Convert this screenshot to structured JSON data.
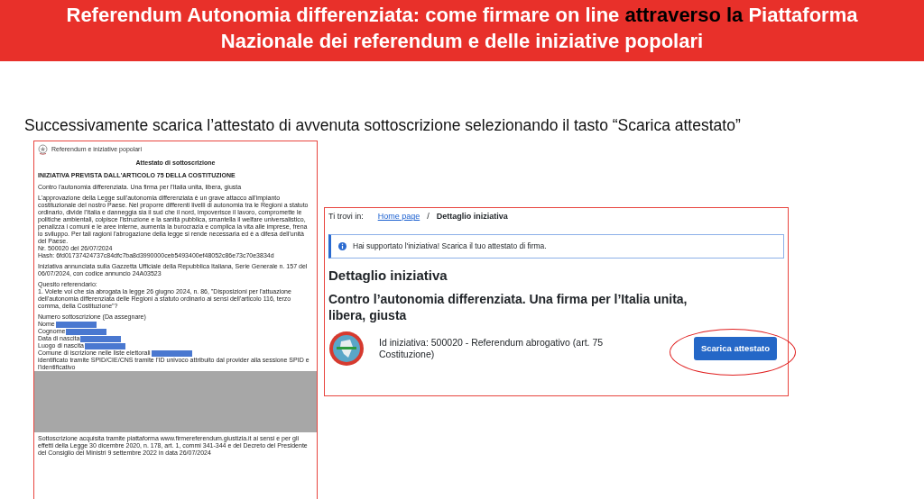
{
  "slide_title": {
    "segments": [
      {
        "text": "Referendum Autonomia differenziata: come firmare on line ",
        "emphasis": false
      },
      {
        "text": "attraverso la",
        "emphasis": true
      },
      {
        "text": " Piattaforma Nazionale dei referendum e delle iniziative popolari",
        "emphasis": false
      }
    ]
  },
  "instruction": "Successivamente scarica l’attestato di avvenuta sottoscrizione selezionando il tasto “Scarica attestato”",
  "certificate": {
    "header": "Referendum e iniziative popolari",
    "title": "Attestato di sottoscrizione",
    "heading": "INIZIATIVA PREVISTA DALL'ARTICOLO 75 DELLA COSTITUZIONE",
    "paragraphs": [
      [
        "Contro l'autonomia differenziata. Una firma per l'Italia unita, libera, giusta"
      ],
      [
        "L'approvazione della Legge sull'autonomia differenziata è un grave attacco all'impianto costituzionale del nostro Paese. Nel proporre differenti livelli di autonomia tra le Regioni a statuto ordinario, divide l'Italia e danneggia sia il sud che il nord, impoverisce il lavoro, compromette le politiche ambientali, colpisce l'istruzione e la sanità pubblica, smantella il welfare universalistico, penalizza i comuni e le aree interne, aumenta la burocrazia e complica la vita alle imprese, frena lo sviluppo. Per tali ragioni l'abrogazione della legge si rende necessaria ed è a difesa dell'unità del Paese.",
        "Nr. 500020 del 26/07/2024",
        "Hash: 6fd01737424737c84dfc7ba8d3990000ceb5493400ef48052c86e73c70e3834d"
      ],
      [
        "Iniziativa annunciata sulla Gazzetta Ufficiale della Repubblica Italiana, Serie Generale n. 157 del 06/07/2024, con codice annuncio 24A03523"
      ],
      [
        "Quesito referendario:",
        "1. Volete voi che sia abrogata la legge 26 giugno 2024, n. 86, \"Disposizioni per l'attuazione dell'autonomia differenziata delle Regioni a statuto ordinario ai sensi dell'articolo 116, terzo comma, della Costituzione\"?"
      ]
    ],
    "subscription_number": "Numero sottoscrizione (Da assegnare)",
    "fields": [
      {
        "label": "Nome",
        "redacted": true
      },
      {
        "label": "Cognome",
        "redacted": true
      },
      {
        "label": "Data di nascita",
        "redacted": true
      },
      {
        "label": "Luogo di nascita",
        "redacted": true
      },
      {
        "label": "Comune di iscrizione nelle liste elettorali",
        "redacted": true
      }
    ],
    "identification": "identificato tramite SPID/CIE/CNS tramite l'ID univoco attribuito dal provider alla sessione SPID e l'identificativo",
    "footer": "Sottoscrizione acquisita tramite piattaforma www.firmereferendum.giustizia.it ai sensi e per gli effetti della Legge 30 dicembre 2020, n. 178, art. 1, commi 341-344 e del Decreto del Presidente del Consiglio dei Ministri 9 settembre 2022 in data 26/07/2024"
  },
  "detail_page": {
    "breadcrumb": {
      "prefix": "Ti trovi in:",
      "separator": "/",
      "items": [
        {
          "label": "Home page",
          "kind": "link"
        },
        {
          "label": "Dettaglio iniziativa",
          "kind": "current"
        }
      ]
    },
    "alert": "Hai supportato l'iniziativa! Scarica il tuo attestato di firma.",
    "page_title": "Dettaglio iniziativa",
    "initiative_title": "Contro l’autonomia differenziata. Una firma per l’Italia unita, libera, giusta",
    "id_text": "Id iniziativa: 500020 - Referendum abrogativo (art. 75 Costituzione)",
    "button": "Scarica attestato"
  }
}
